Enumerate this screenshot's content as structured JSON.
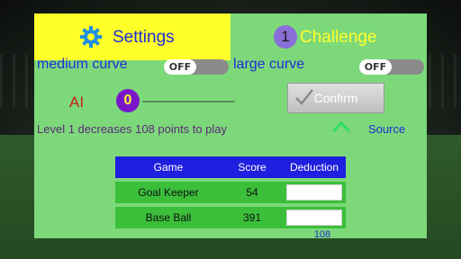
{
  "tabs": {
    "settings_label": "Settings",
    "challenge_label": "Challenge",
    "challenge_count": "1"
  },
  "options": {
    "medium_curve_label": "medium curve",
    "medium_curve_state": "OFF",
    "large_curve_label": "large curve",
    "large_curve_state": "OFF"
  },
  "ai": {
    "label": "AI",
    "value": "0"
  },
  "confirm_label": "Confirm",
  "level_text": "Level 1 decreases 108 points to play",
  "source_label": "Source",
  "table": {
    "headers": [
      "Game",
      "Score",
      "Deduction"
    ],
    "rows": [
      {
        "game": "Goal Keeper",
        "score": "54",
        "deduction": ""
      },
      {
        "game": "Base Ball",
        "score": "391",
        "deduction": ""
      }
    ],
    "total": "108"
  },
  "colors": {
    "panel": "#7dd87a",
    "tab_active": "#ffff2a",
    "header": "#1f1fe0",
    "row": "#3bbf3b"
  },
  "icons": [
    "gear-icon",
    "check-icon",
    "chevron-up-icon"
  ]
}
